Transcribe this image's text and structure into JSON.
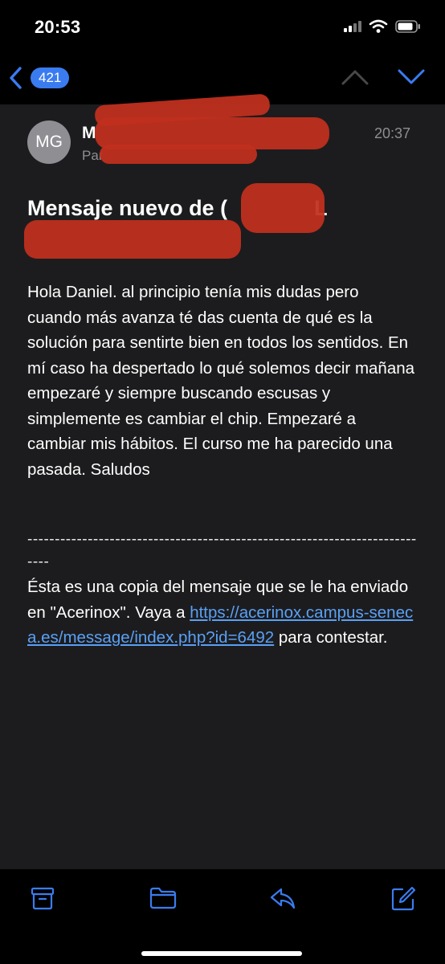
{
  "status": {
    "time": "20:53"
  },
  "nav": {
    "count": "421"
  },
  "message": {
    "avatar_initials": "MG",
    "sender_visible": "M",
    "recipient_visible": "Par",
    "time": "20:37",
    "subject_line1": "Mensaje nuevo de (",
    "subject_line1_tail": "L",
    "body": "Hola Daniel. al principio tenía mis dudas pero cuando más avanza té das cuenta de qué es la solución para sentirte bien en todos los sentidos. En mí caso ha despertado lo qué solemos decir mañana empezaré y siempre buscando escusas y simplemente es cambiar el chip. Empezaré a cambiar mis hábitos. El curso me ha parecido una pasada. Saludos",
    "separator": "---------------------------------------------------------------------------",
    "footer_prefix": "Ésta es una copia del mensaje que se le ha enviado en \"Acerinox\". Vaya a ",
    "footer_link": "https://acerinox.campus-seneca.es/message/index.php?id=6492",
    "footer_suffix": " para contestar."
  },
  "icons": {
    "back": "chevron-left-icon",
    "up": "chevron-up-icon",
    "down": "chevron-down-icon",
    "archive": "archive-icon",
    "folder": "folder-icon",
    "reply": "reply-icon",
    "compose": "compose-icon"
  },
  "colors": {
    "accent": "#3a7cf0",
    "link": "#5aa0f5",
    "redaction": "#c0301e",
    "mail_background": "#1c1c1e"
  }
}
